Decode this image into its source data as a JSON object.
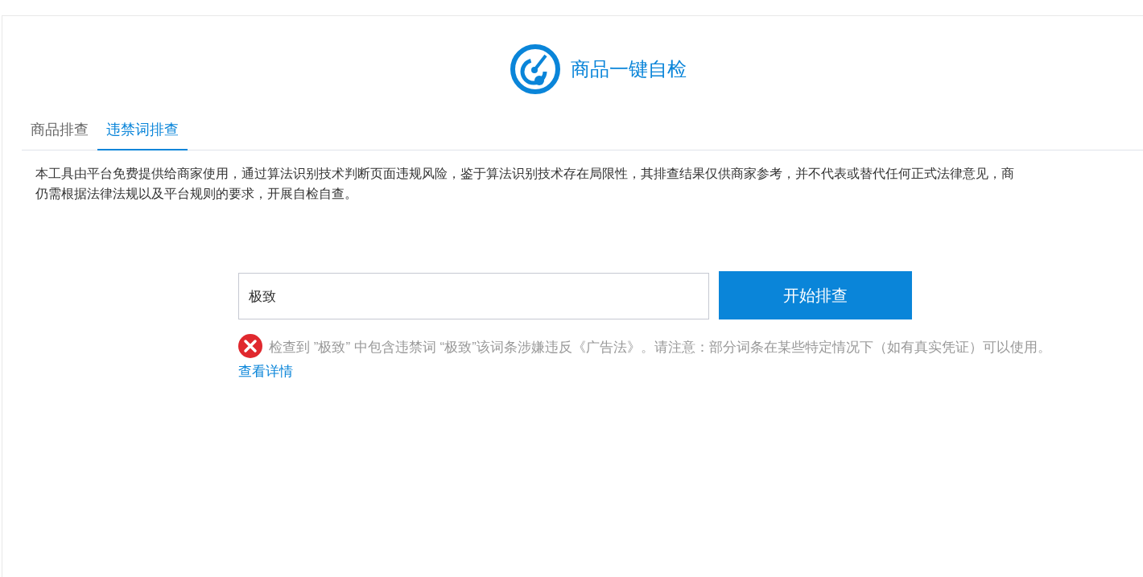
{
  "header": {
    "title": "商品一键自检"
  },
  "tabs": [
    {
      "label": "商品排查",
      "selected": false
    },
    {
      "label": "违禁词排查",
      "selected": true
    }
  ],
  "disclaimer": [
    "本工具由平台免费提供给商家使用，通过算法识别技术判断页面违规风险，鉴于算法识别技术存在局限性，其排查结果仅供商家参考，并不代表或替代任何正式法律意见，商",
    "仍需根据法律法规以及平台规则的要求，开展自检自查。"
  ],
  "search": {
    "value": "极致",
    "button": "开始排查"
  },
  "result": {
    "kind": "error",
    "message": "检查到 ”极致” 中包含违禁词 “极致”该词条涉嫌违反《广告法》。请注意：部分词条在某些特定情况下（如有真实凭证）可以使用。",
    "link": "查看详情"
  }
}
